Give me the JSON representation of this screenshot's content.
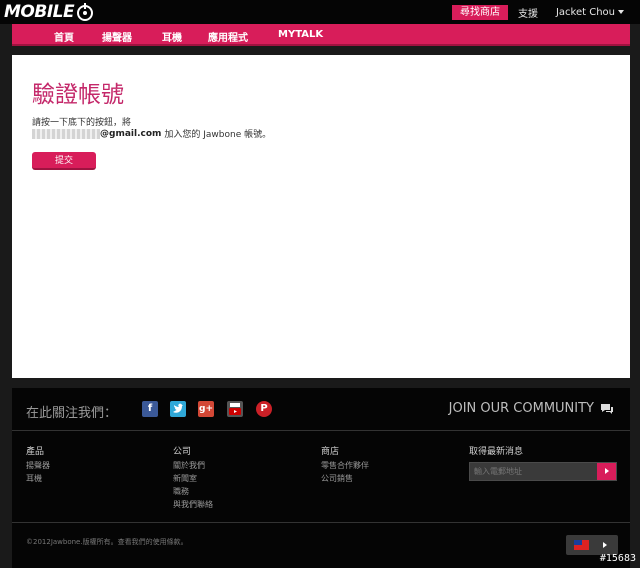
{
  "topbar": {
    "logo_text": "MOBILE",
    "shop_label": "尋找商店",
    "support_label": "支援",
    "user_label": "Jacket Chou"
  },
  "nav": {
    "items": [
      "首頁",
      "揚聲器",
      "耳機",
      "應用程式",
      "MYTALK"
    ]
  },
  "page": {
    "title": "驗證帳號",
    "instruction": "請按一下底下的按鈕，將",
    "email_domain": "@gmail.com",
    "instruction_tail": "加入您的 Jawbone 帳號。",
    "submit_label": "提交"
  },
  "footer": {
    "follow_label": "在此關注我們：",
    "community_label": "JOIN OUR COMMUNITY",
    "social_icons": [
      "facebook-icon",
      "twitter-icon",
      "google-plus-icon",
      "youtube-icon",
      "pinterest-icon"
    ],
    "columns": [
      {
        "heading": "產品",
        "items": [
          "揚聲器",
          "耳機"
        ]
      },
      {
        "heading": "公司",
        "items": [
          "關於我們",
          "新聞室",
          "職務",
          "與我們聯絡"
        ]
      },
      {
        "heading": "商店",
        "items": [
          "零售合作夥伴",
          "公司銷售"
        ]
      },
      {
        "heading": "取得最新消息",
        "items": []
      }
    ],
    "subscribe_placeholder": "輸入電郵地址",
    "copyright": "©2012Jawbone.版權所有。查看我們的使用條款。"
  },
  "watermark": "#15683",
  "colors": {
    "accent": "#d81d5a",
    "title": "#c4286a"
  }
}
